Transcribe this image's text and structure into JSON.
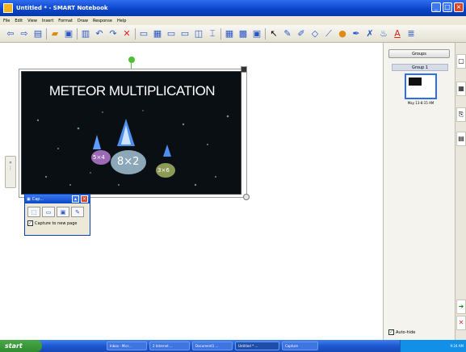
{
  "window": {
    "title": "Untitled * - SMART Notebook",
    "controls": [
      "_",
      "□",
      "×"
    ]
  },
  "menubar": [
    "File",
    "Edit",
    "View",
    "Insert",
    "Format",
    "Draw",
    "Response",
    "Help"
  ],
  "toolbar": {
    "icons": [
      "previous-page-icon",
      "next-page-icon",
      "add-page-icon",
      "open-icon",
      "save-icon",
      "paste-icon",
      "undo-icon",
      "redo-icon",
      "delete-icon",
      "screen-shade-icon",
      "table-icon",
      "document-camera-icon",
      "capture-icon",
      "dual-page-icon",
      "full-screen-icon",
      "select-icon",
      "pen-icon",
      "creative-pen-icon",
      "eraser-icon",
      "line-icon",
      "shapes-icon",
      "magic-pen-icon",
      "fill-icon",
      "text-icon",
      "more-icon"
    ]
  },
  "slide": {
    "title": "METEOR MULTIPLICATION",
    "meteors": [
      "5×4",
      "8×2",
      "3×6"
    ]
  },
  "capture_toolbar": {
    "title": "Cap...",
    "option_label": "Capture to new page",
    "option_checked": true
  },
  "page_sorter": {
    "groups_button": "Groups",
    "group_label": "Group 1",
    "thumbnail_label": "May 13-8:15 AM",
    "autohide_label": "Auto-hide",
    "autohide_checked": true
  },
  "taskbar": {
    "start_label": "start",
    "buttons": [
      "Inbox - Micr...",
      "2 Internet ...",
      "Document1 ...",
      "Untitled * ...",
      "Capture"
    ],
    "active_index": 3,
    "clock": "9:24 AM"
  }
}
